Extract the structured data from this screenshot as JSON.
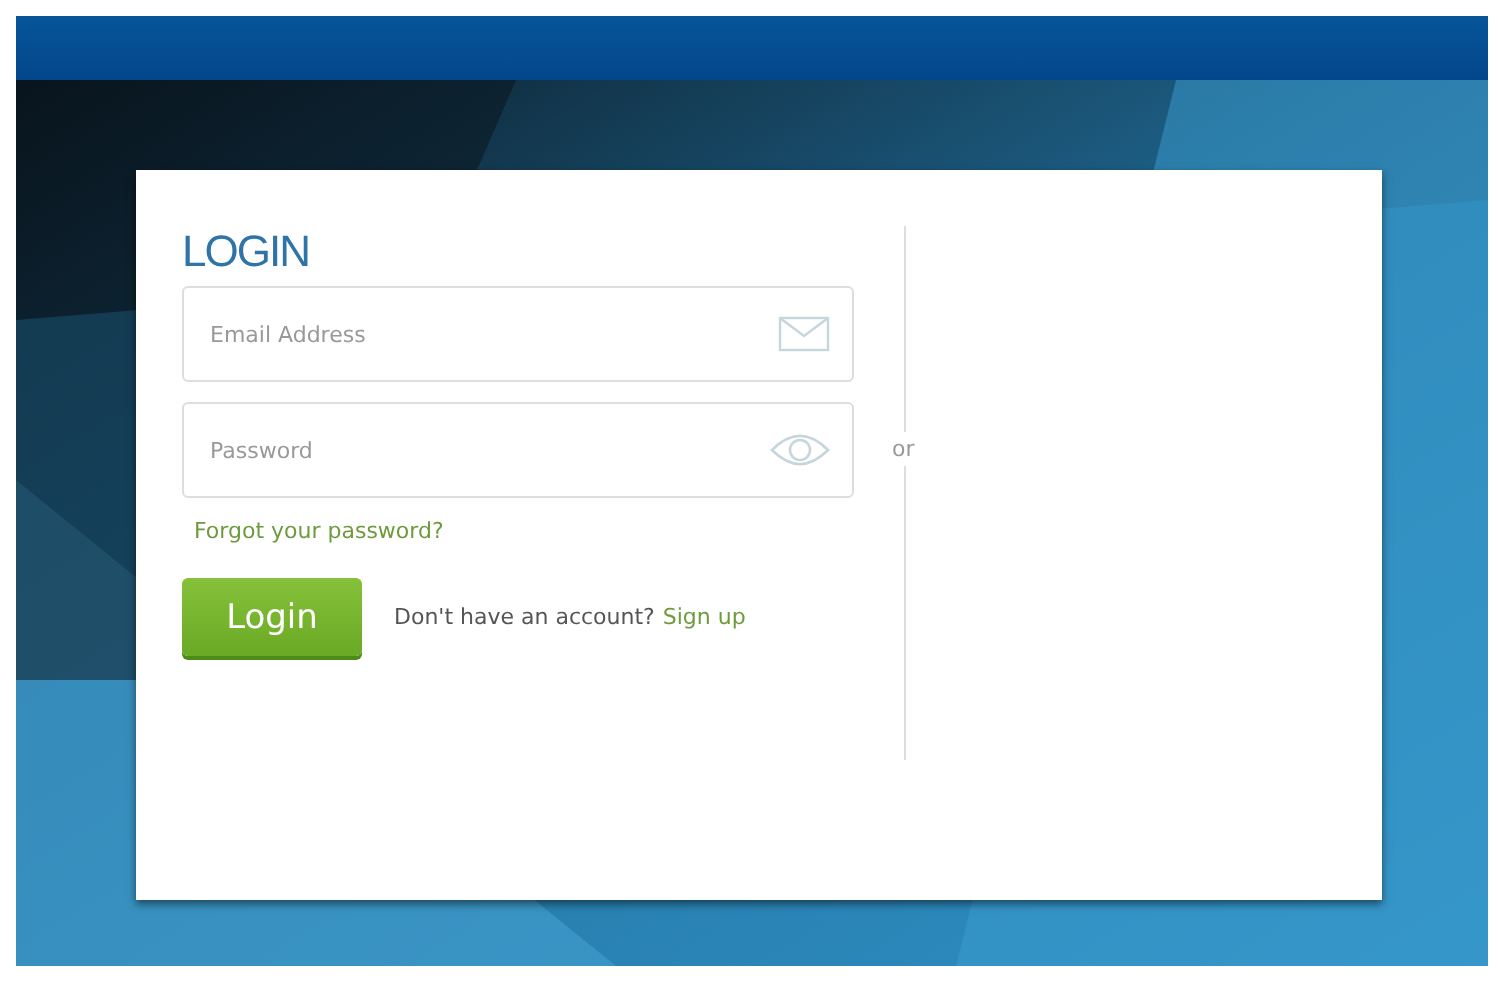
{
  "login": {
    "title": "LOGIN",
    "fields": [
      {
        "kind": "email",
        "placeholder": "Email Address"
      },
      {
        "kind": "password",
        "placeholder": "Password"
      }
    ],
    "forgot_link": "Forgot your password?",
    "button": "Login",
    "signup_prompt": "Don't have an account?",
    "signup_link": "Sign up",
    "separator": "or"
  }
}
